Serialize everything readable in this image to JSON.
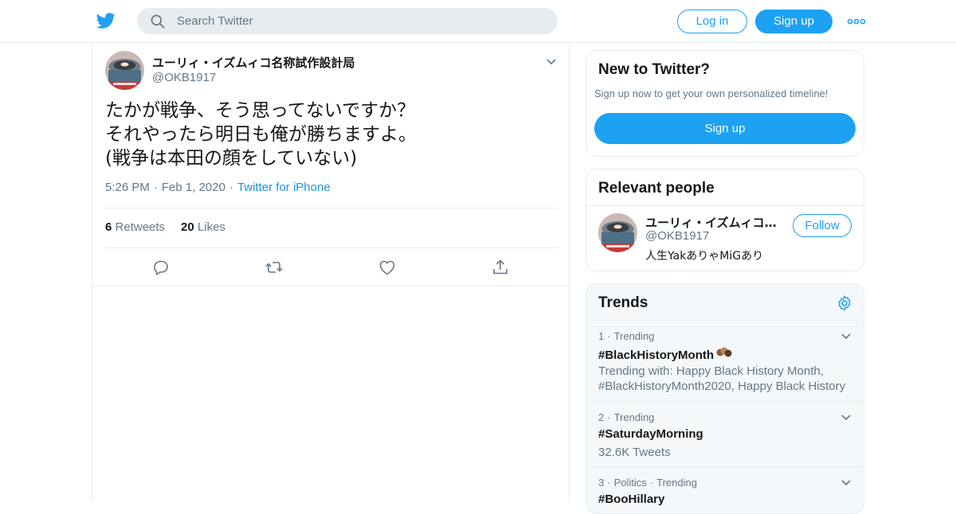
{
  "header": {
    "search_placeholder": "Search Twitter",
    "login_label": "Log in",
    "signup_label": "Sign up"
  },
  "tweet": {
    "author_name": "ユーリィ・イズムィコ名称試作設計局",
    "author_handle": "@OKB1917",
    "text_lines": [
      "たかが戦争、そう思ってないですか？",
      "それやったら明日も俺が勝ちますよ。",
      "(戦争は本田の顔をしていない)"
    ],
    "time": "5:26 PM",
    "date": "Feb 1, 2020",
    "source": "Twitter for iPhone",
    "retweets_count": "6",
    "retweets_label": "Retweets",
    "likes_count": "20",
    "likes_label": "Likes"
  },
  "new_to_twitter": {
    "title": "New to Twitter?",
    "subtitle": "Sign up now to get your own personalized timeline!",
    "signup_label": "Sign up"
  },
  "relevant_people": {
    "title": "Relevant people",
    "person": {
      "name": "ユーリィ・イズムィコ名称試作設計局",
      "handle": "@OKB1917",
      "bio": "人生YakありゃMiGあり",
      "follow_label": "Follow"
    }
  },
  "trends": {
    "title": "Trends",
    "items": [
      {
        "rank": "1",
        "category": "",
        "label": "Trending",
        "name": "#BlackHistoryMonth",
        "desc": "Trending with: Happy Black History Month, #BlackHistoryMonth2020, Happy Black History"
      },
      {
        "rank": "2",
        "category": "",
        "label": "Trending",
        "name": "#SaturdayMorning",
        "desc": "32.6K Tweets"
      },
      {
        "rank": "3",
        "category": "Politics",
        "label": "Trending",
        "name": "#BooHillary",
        "desc": ""
      }
    ]
  },
  "colors": {
    "brand_blue": "#1da1f2",
    "link_blue": "#1b95e0",
    "muted_gray": "#657786",
    "border": "#e6ecf0"
  }
}
